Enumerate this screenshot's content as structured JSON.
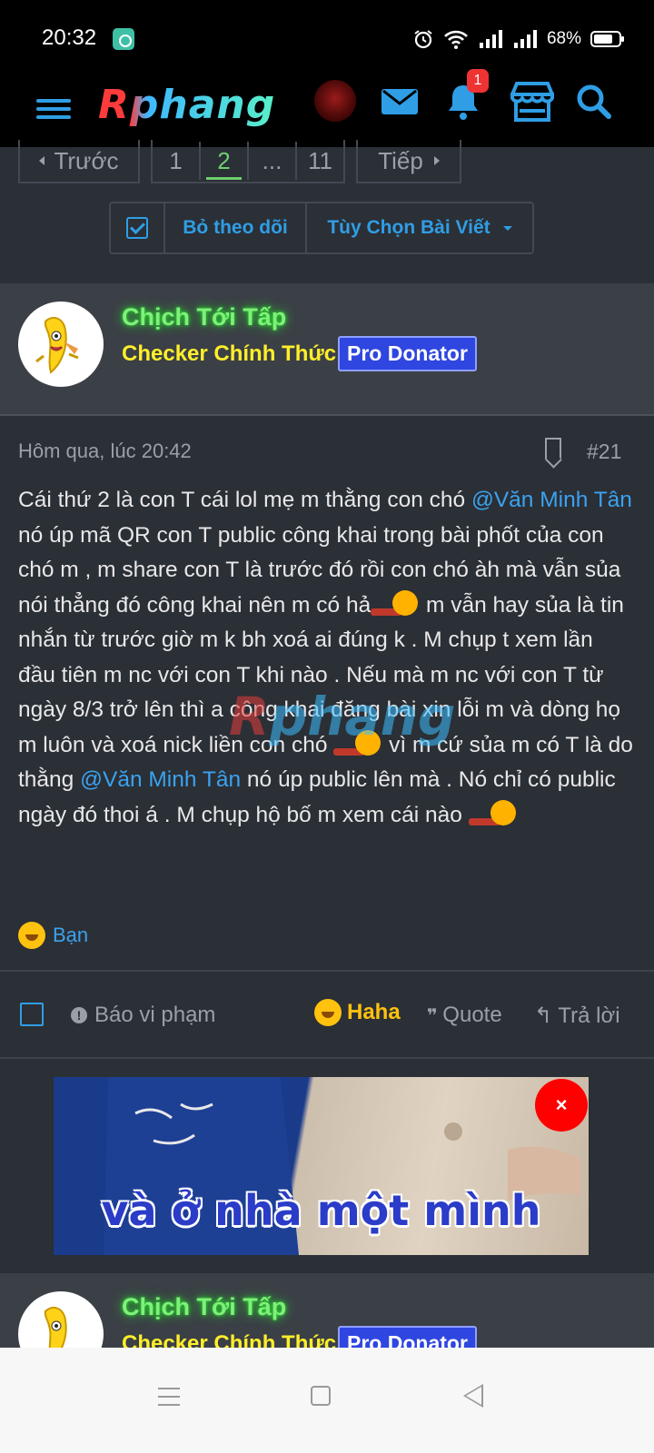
{
  "status_bar": {
    "time": "20:32",
    "battery": "68%"
  },
  "header": {
    "logo": "Rphang",
    "notification_count": "1",
    "icons": [
      "menu-icon",
      "profile-avatar",
      "mail-icon",
      "bell-icon",
      "store-icon",
      "search-icon"
    ]
  },
  "pagination": {
    "prev": "Trước",
    "pages": [
      "1",
      "2",
      "...",
      "11"
    ],
    "active_page": "2",
    "next": "Tiếp"
  },
  "thread_tools": {
    "unwatch": "Bỏ theo dõi",
    "options": "Tùy Chọn Bài Viết"
  },
  "post": {
    "user": {
      "name": "Chịch Tới Tấp",
      "title": "Checker Chính Thức",
      "badge": "Pro Donator"
    },
    "date": "Hôm qua, lúc 20:42",
    "number": "#21",
    "body": {
      "p1": "Cái thứ 2 là con T cái lol mẹ m thằng con chó ",
      "mention1": "@Văn Minh Tân",
      "p2": " nó úp mã QR con T public công khai trong bài phốt của con chó m , m share con T là trước đó rồi con chó àh mà vẫn sủa nói thẳng đó công khai nên m có hả",
      "p3": " m vẫn hay sủa là tin nhắn từ trước giờ m k bh xoá ai đúng k . M chụp t xem lần đầu tiên m nc với con T khi nào . Nếu mà m nc với con T từ ngày 8/3 trở lên thì a công khai đăng bài xin lỗi m và dòng họ m luôn và xoá nick liền con chó ",
      "p4": " vì m cứ sủa m có T là do thằng ",
      "mention2": "@Văn Minh Tân",
      "p5": " nó úp public lên mà . Nó chỉ có public ngày đó thoi á . M chụp hộ bố m xem cái nào "
    },
    "watermark": {
      "a": "R",
      "b": "phang"
    },
    "reaction_user": "Bạn",
    "actions": {
      "report": "Báo vi phạm",
      "haha": "Haha",
      "quote": "Quote",
      "reply": "Trả lời"
    }
  },
  "ad": {
    "caption": "và ở nhà một mình",
    "close": "×"
  },
  "next_post": {
    "user": {
      "name": "Chịch Tới Tấp",
      "title": "Checker Chính Thức",
      "badge": "Pro Donator"
    }
  },
  "colors": {
    "accent": "#2f9ee5",
    "username": "#7ff07a",
    "usertitle": "#ffef2a",
    "badge": "#2f46e0",
    "haha": "#ffc20e"
  }
}
